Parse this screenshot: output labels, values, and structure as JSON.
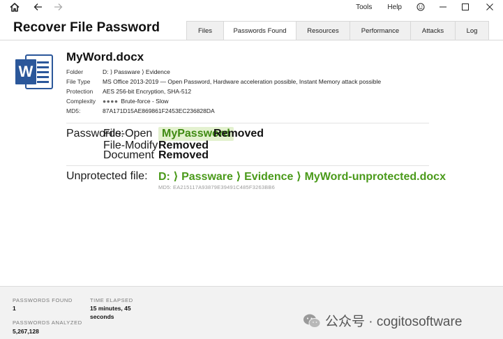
{
  "titlebar": {
    "tools_label": "Tools",
    "help_label": "Help"
  },
  "header": {
    "title": "Recover File Password",
    "tabs": [
      {
        "label": "Files",
        "active": false
      },
      {
        "label": "Passwords Found",
        "active": true
      },
      {
        "label": "Resources",
        "active": false
      },
      {
        "label": "Performance",
        "active": false
      },
      {
        "label": "Attacks",
        "active": false
      },
      {
        "label": "Log",
        "active": false
      }
    ]
  },
  "file": {
    "icon_letter": "W",
    "name": "MyWord.docx",
    "details": [
      {
        "label": "Folder",
        "value": "D: ⟩ Passware ⟩ Evidence"
      },
      {
        "label": "File Type",
        "value": "MS Office 2013-2019 — Open Password, Hardware acceleration possible, Instant Memory attack possible"
      },
      {
        "label": "Protection",
        "value": "AES 256-bit Encryption, SHA-512"
      },
      {
        "label": "Complexity",
        "dots": "●●●●",
        "value": "Brute-force - Slow"
      },
      {
        "label": "MD5:",
        "value": "87A171D15AE869861F2453EC236828DA"
      }
    ]
  },
  "passwords": {
    "section_label": "Passwords:",
    "rows": [
      {
        "type": "File-Open",
        "password": "MyPassword",
        "status": "Removed"
      },
      {
        "type": "File-Modify",
        "status": "Removed"
      },
      {
        "type": "Document",
        "status": "Removed"
      }
    ]
  },
  "unprotected": {
    "label": "Unprotected file:",
    "path": "D: ⟩ Passware ⟩ Evidence ⟩ MyWord-unprotected.docx",
    "md5": "MD5: EA215117A93879E39491C485F3263BB6"
  },
  "footer": {
    "passwords_found_label": "PASSWORDS FOUND",
    "passwords_found_value": "1",
    "time_elapsed_label": "TIME ELAPSED",
    "time_elapsed_value_line1": "15 minutes, 45",
    "time_elapsed_value_line2": "seconds",
    "passwords_analyzed_label": "PASSWORDS ANALYZED",
    "passwords_analyzed_value": "5,267,128"
  },
  "watermark": {
    "text": "公众号 · cogitosoftware"
  },
  "colors": {
    "word_blue": "#2b579a",
    "found_green": "#4a9a1a",
    "pill_bg": "#e3f1cf"
  },
  "icons": [
    "home-icon",
    "back-arrow-icon",
    "forward-arrow-icon",
    "smiley-icon",
    "minimize-icon",
    "maximize-icon",
    "close-icon",
    "word-file-icon"
  ]
}
